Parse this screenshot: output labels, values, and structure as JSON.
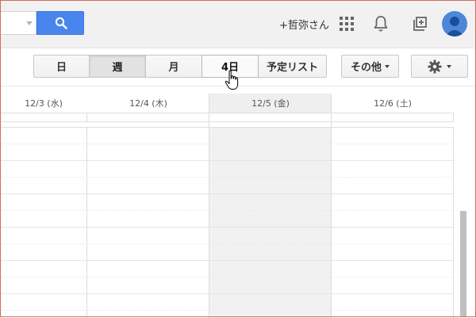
{
  "header": {
    "user_name": "+哲弥さん",
    "icons": {
      "search": "search-icon",
      "apps": "apps-grid-icon",
      "notifications": "bell-icon",
      "share": "add-box-icon",
      "avatar": "account-avatar-icon"
    },
    "search_button_color": "#4885ed"
  },
  "toolbar": {
    "views": [
      {
        "label": "日",
        "selected": false
      },
      {
        "label": "週",
        "selected": true
      },
      {
        "label": "月",
        "selected": false
      },
      {
        "label": "4日",
        "selected": false
      },
      {
        "label": "予定リスト",
        "selected": false
      }
    ],
    "more_label": "その他",
    "settings_icon": "gear-icon"
  },
  "calendar": {
    "days": [
      {
        "label": "12/3 (水)",
        "today": false
      },
      {
        "label": "12/4 (木)",
        "today": false
      },
      {
        "label": "12/5 (金)",
        "today": true
      },
      {
        "label": "12/6 (土)",
        "today": false
      }
    ],
    "today_color": "#f1f1f1"
  }
}
